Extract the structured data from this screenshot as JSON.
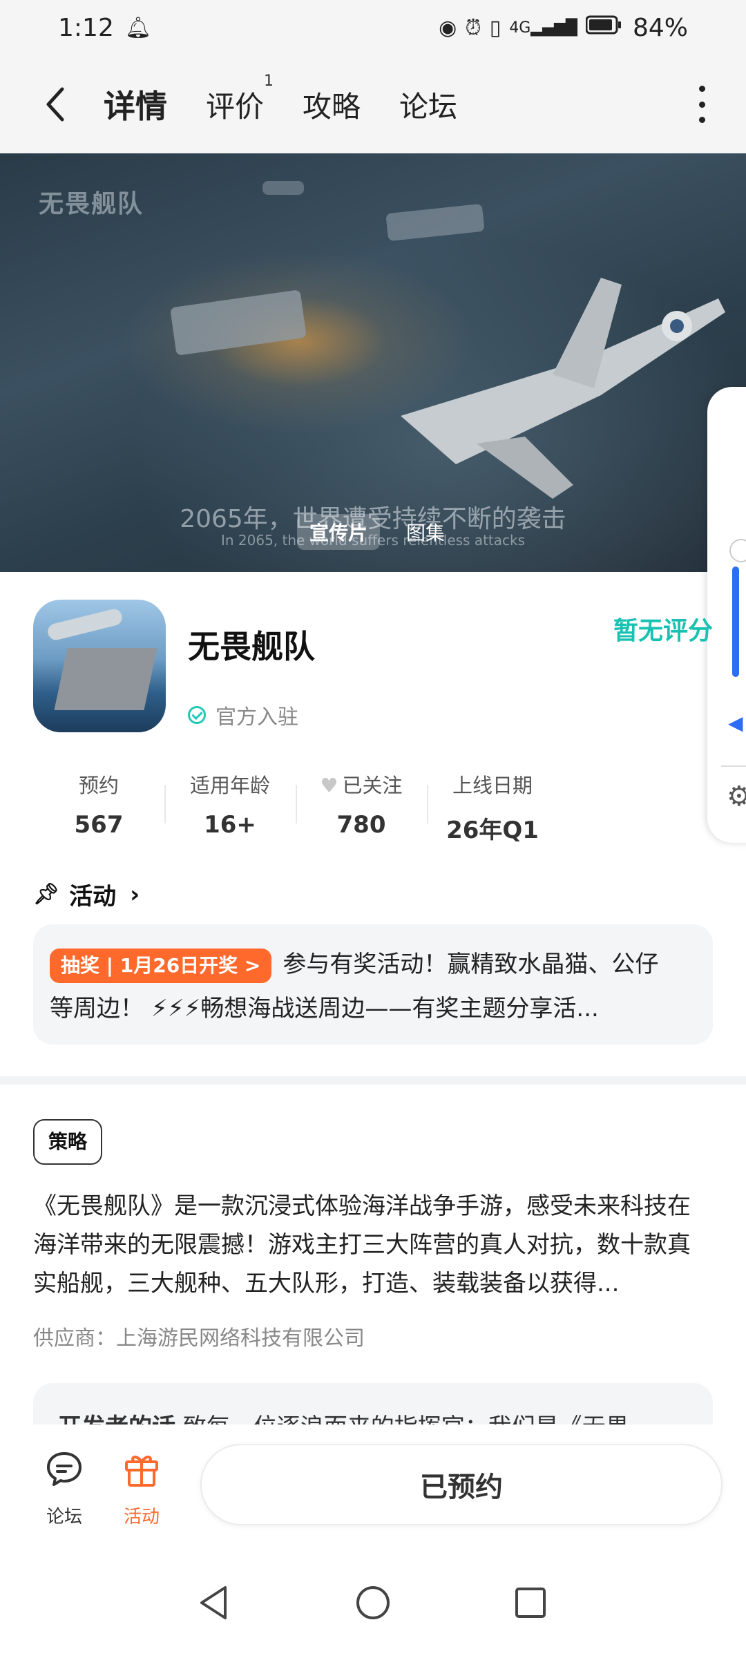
{
  "status_bar": {
    "time": "1:12",
    "battery": "84%",
    "icons": [
      "notification-bell-icon",
      "eye-icon",
      "alarm-icon",
      "vibrate-icon",
      "4g-signal-icon",
      "battery-icon"
    ]
  },
  "nav": {
    "tabs": [
      {
        "label": "详情",
        "active": true,
        "badge": ""
      },
      {
        "label": "评价",
        "active": false,
        "badge": "1"
      },
      {
        "label": "攻略",
        "active": false,
        "badge": ""
      },
      {
        "label": "论坛",
        "active": false,
        "badge": ""
      }
    ]
  },
  "hero": {
    "logo": "无畏舰队",
    "caption": "2065年，世界遭受持续不断的袭击",
    "caption_en": "In 2065, the world suffers relentless attacks",
    "tabs": [
      {
        "label": "宣传片",
        "active": true
      },
      {
        "label": "图集",
        "active": false
      }
    ]
  },
  "app": {
    "name": "无畏舰队",
    "official_label": "官方入驻",
    "rating": "暂无评分"
  },
  "stats": [
    {
      "label": "预约",
      "value": "567"
    },
    {
      "label": "适用年龄",
      "value": "16+"
    },
    {
      "label": "已关注",
      "value": "780"
    },
    {
      "label": "上线日期",
      "value": "26年Q1"
    }
  ],
  "activity": {
    "heading": "活动",
    "badge": "抽奖 | 1月26日开奖 >",
    "text_line1": "参与有奖活动！赢精致水晶猫、公仔",
    "text_line2": "等周边！ ⚡⚡⚡畅想海战送周边——有奖主题分享活..."
  },
  "details": {
    "tag": "策略",
    "description": "《无畏舰队》是一款沉浸式体验海洋战争手游，感受未来科技在海洋带来的无限震撼！游戏主打三大阵营的真人对抗，数十款真实船舰，三大舰种、五大队形，打造、装载装备以获得...",
    "supplier": "供应商：上海游民网络科技有限公司",
    "dev_words_title": "开发者的话",
    "dev_words_text": "致每一位逐浪而来的指挥官：我们是《无畏"
  },
  "bottom_bar": {
    "forum_label": "论坛",
    "activity_label": "活动",
    "reserved_label": "已预约",
    "activity_color": "#ff6a2c"
  },
  "colors": {
    "accent": "#1fd1c4",
    "rating": "#18c2b2",
    "badge": "#ff6a2c"
  }
}
